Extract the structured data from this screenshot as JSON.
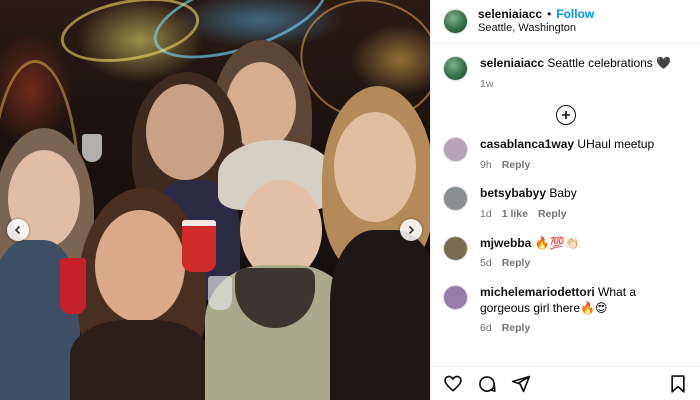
{
  "header": {
    "username": "seleniaiacc",
    "separator": "•",
    "follow_label": "Follow",
    "location": "Seattle, Washington"
  },
  "caption": {
    "username": "seleniaiacc",
    "text": "Seattle celebrations 🖤",
    "time": "1w"
  },
  "load_more_icon": "plus-circle-icon",
  "comments": [
    {
      "username": "casablanca1way",
      "text": "UHaul meetup",
      "time": "9h",
      "likes": "",
      "reply": "Reply",
      "avatar_color": "#b9a2b8"
    },
    {
      "username": "betsybabyy",
      "text": "Baby",
      "time": "1d",
      "likes": "1 like",
      "reply": "Reply",
      "avatar_color": "#8a8f92"
    },
    {
      "username": "mjwebba",
      "text": "🔥💯👏🏻",
      "time": "5d",
      "likes": "",
      "reply": "Reply",
      "avatar_color": "#7a6a52"
    },
    {
      "username": "michelemariodettori",
      "text": "What a gorgeous girl there🔥😍",
      "time": "6d",
      "likes": "",
      "reply": "Reply",
      "avatar_color": "#9a7aa8"
    }
  ],
  "actions": [
    "heart-icon",
    "comment-icon",
    "share-icon",
    "bookmark-icon"
  ],
  "colors": {
    "follow": "#0095f6",
    "meta": "#737373",
    "border": "#efefef"
  }
}
